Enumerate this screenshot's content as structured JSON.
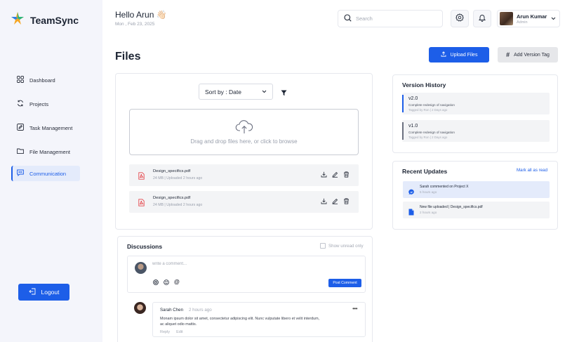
{
  "brand": {
    "name": "TeamSync"
  },
  "header": {
    "greeting": "Hello Arun 👋🏻",
    "date": "Mon , Feb 23, 2025",
    "search_placeholder": "Search",
    "user": {
      "name": "Arun Kumar",
      "role": "Admin"
    }
  },
  "sidebar": {
    "items": [
      {
        "label": "Dashboard",
        "icon": "grid-icon"
      },
      {
        "label": "Projects",
        "icon": "refresh-icon"
      },
      {
        "label": "Task Management",
        "icon": "edit-icon"
      },
      {
        "label": "File Management",
        "icon": "folder-icon"
      },
      {
        "label": "Communication",
        "icon": "chat-icon",
        "active": true
      }
    ],
    "logout_label": "Logout"
  },
  "page": {
    "title": "Files",
    "upload_button": "Upload Files",
    "version_tag_button": "Add Version Tag"
  },
  "files": {
    "sort_label": "Sort by : Date",
    "dropzone_text": "Drag and drop files here, or click to browse",
    "items": [
      {
        "name": "Design_specifics.pdf",
        "meta": "24 MB | Uploaded 2 hours ago"
      },
      {
        "name": "Design_specifics.pdf",
        "meta": "24 MB | Uploaded 2 hours ago"
      }
    ]
  },
  "discussions": {
    "title": "Discussions",
    "unread_label": "Show unread only",
    "comment_placeholder": "write a comment...",
    "post_label": "Post Comment",
    "comments": [
      {
        "author": "Sarah Chen",
        "time": "2 hours ago",
        "text": "Monam ipsum dolor sit amet, consectetur adipiscing elit. Nunc vulputate libero et velit interdum, ac aliquet odio mattis.",
        "reply_label": "Reply",
        "edit_label": "Edit"
      }
    ]
  },
  "version_history": {
    "title": "Version History",
    "items": [
      {
        "version": "v2.0",
        "description": "Complete redesign of navigation",
        "tagged": "Tagged by Ron | 2 Days ago",
        "color": "#1d5ee8"
      },
      {
        "version": "v1.0",
        "description": "Complete redesign of navigation",
        "tagged": "Tagged by Ron | 2 Days ago",
        "color": "#6b7080"
      }
    ]
  },
  "recent_updates": {
    "title": "Recent Updates",
    "mark_all": "Mark all as read",
    "items": [
      {
        "text": "Sarah commented on Project X",
        "time": "5 hours ago",
        "icon": "comment-icon",
        "highlight": true
      },
      {
        "text": "New file uploaded | Design_specifics.pdf",
        "time": "2 hours ago",
        "icon": "file-icon",
        "highlight": false
      }
    ]
  },
  "colors": {
    "accent": "#1d5ee8",
    "sidebar_bg": "#f4f5fb",
    "highlight_bg": "#e4ebfb",
    "pdf_red": "#e5484d"
  }
}
